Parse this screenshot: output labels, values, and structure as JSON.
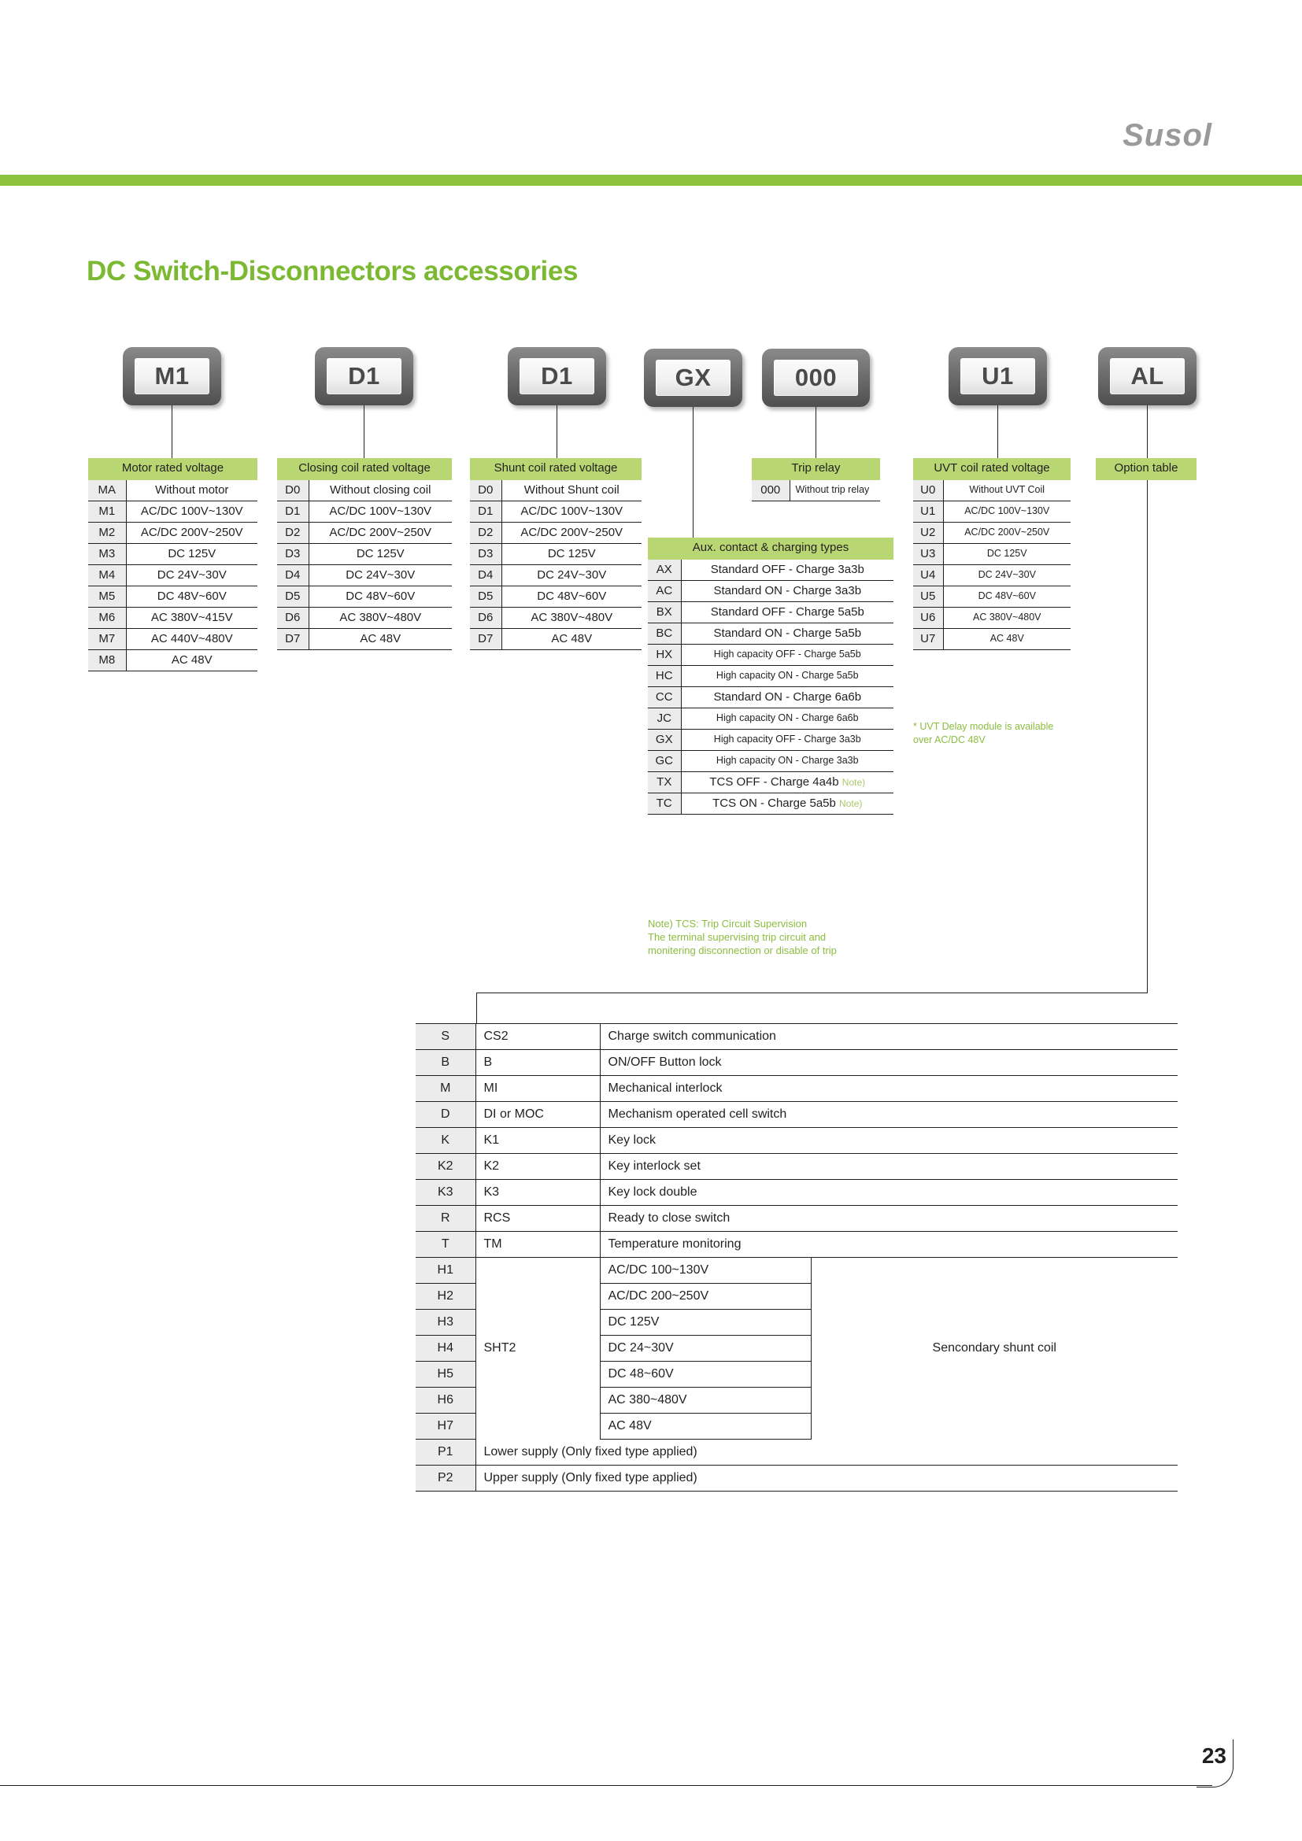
{
  "header": {
    "brand": "Susol",
    "page_title": "DC Switch-Disconnectors accessories"
  },
  "badges": [
    {
      "label": "M1"
    },
    {
      "label": "D1"
    },
    {
      "label": "D1"
    },
    {
      "label": "GX"
    },
    {
      "label": "000"
    },
    {
      "label": "U1"
    },
    {
      "label": "AL"
    }
  ],
  "sections": {
    "motor": {
      "title": "Motor rated voltage",
      "rows": [
        {
          "code": "MA",
          "value": "Without motor"
        },
        {
          "code": "M1",
          "value": "AC/DC 100V~130V"
        },
        {
          "code": "M2",
          "value": "AC/DC 200V~250V"
        },
        {
          "code": "M3",
          "value": "DC 125V"
        },
        {
          "code": "M4",
          "value": "DC 24V~30V"
        },
        {
          "code": "M5",
          "value": "DC 48V~60V"
        },
        {
          "code": "M6",
          "value": "AC 380V~415V"
        },
        {
          "code": "M7",
          "value": "AC 440V~480V"
        },
        {
          "code": "M8",
          "value": "AC 48V"
        }
      ]
    },
    "closing": {
      "title": "Closing coil rated voltage",
      "rows": [
        {
          "code": "D0",
          "value": "Without closing coil"
        },
        {
          "code": "D1",
          "value": "AC/DC 100V~130V"
        },
        {
          "code": "D2",
          "value": "AC/DC 200V~250V"
        },
        {
          "code": "D3",
          "value": "DC 125V"
        },
        {
          "code": "D4",
          "value": "DC 24V~30V"
        },
        {
          "code": "D5",
          "value": "DC 48V~60V"
        },
        {
          "code": "D6",
          "value": "AC 380V~480V"
        },
        {
          "code": "D7",
          "value": "AC 48V"
        }
      ]
    },
    "shunt": {
      "title": "Shunt coil rated voltage",
      "rows": [
        {
          "code": "D0",
          "value": "Without Shunt coil"
        },
        {
          "code": "D1",
          "value": "AC/DC 100V~130V"
        },
        {
          "code": "D2",
          "value": "AC/DC 200V~250V"
        },
        {
          "code": "D3",
          "value": "DC 125V"
        },
        {
          "code": "D4",
          "value": "DC 24V~30V"
        },
        {
          "code": "D5",
          "value": "DC 48V~60V"
        },
        {
          "code": "D6",
          "value": "AC 380V~480V"
        },
        {
          "code": "D7",
          "value": "AC 48V"
        }
      ]
    },
    "trip": {
      "title": "Trip relay",
      "rows": [
        {
          "code": "000",
          "value": "Without trip relay"
        }
      ]
    },
    "aux": {
      "title": "Aux. contact & charging types",
      "rows": [
        {
          "code": "AX",
          "value": "Standard OFF - Charge 3a3b",
          "note": ""
        },
        {
          "code": "AC",
          "value": "Standard ON - Charge 3a3b",
          "note": ""
        },
        {
          "code": "BX",
          "value": "Standard OFF - Charge 5a5b",
          "note": ""
        },
        {
          "code": "BC",
          "value": "Standard ON - Charge 5a5b",
          "note": ""
        },
        {
          "code": "HX",
          "value": "High capacity OFF - Charge 5a5b",
          "note": ""
        },
        {
          "code": "HC",
          "value": "High capacity ON - Charge 5a5b",
          "note": ""
        },
        {
          "code": "CC",
          "value": "Standard ON - Charge 6a6b",
          "note": ""
        },
        {
          "code": "JC",
          "value": "High capacity ON - Charge 6a6b",
          "note": ""
        },
        {
          "code": "GX",
          "value": "High capacity OFF - Charge 3a3b",
          "note": ""
        },
        {
          "code": "GC",
          "value": "High capacity ON - Charge 3a3b",
          "note": ""
        },
        {
          "code": "TX",
          "value": "TCS OFF - Charge 4a4b",
          "note": "Note)"
        },
        {
          "code": "TC",
          "value": "TCS ON - Charge 5a5b",
          "note": "Note)"
        }
      ],
      "footnote": "Note) TCS: Trip Circuit Supervision\nThe terminal supervising trip circuit and\nmonitering disconnection or disable of trip"
    },
    "uvt": {
      "title": "UVT coil rated voltage",
      "rows": [
        {
          "code": "U0",
          "value": "Without UVT Coil"
        },
        {
          "code": "U1",
          "value": "AC/DC 100V~130V"
        },
        {
          "code": "U2",
          "value": "AC/DC 200V~250V"
        },
        {
          "code": "U3",
          "value": "DC 125V"
        },
        {
          "code": "U4",
          "value": "DC 24V~30V"
        },
        {
          "code": "U5",
          "value": "DC 48V~60V"
        },
        {
          "code": "U6",
          "value": "AC 380V~480V"
        },
        {
          "code": "U7",
          "value": "AC 48V"
        }
      ],
      "footnote": "* UVT Delay module is available\n  over AC/DC 48V"
    },
    "option": {
      "title": "Option table"
    }
  },
  "option_table": {
    "simple_rows": [
      {
        "code": "S",
        "mid": "CS2",
        "desc": "Charge switch communication"
      },
      {
        "code": "B",
        "mid": "B",
        "desc": "ON/OFF Button lock"
      },
      {
        "code": "M",
        "mid": "MI",
        "desc": "Mechanical interlock"
      },
      {
        "code": "D",
        "mid": "DI or MOC",
        "desc": "Mechanism operated cell switch"
      },
      {
        "code": "K",
        "mid": "K1",
        "desc": "Key lock"
      },
      {
        "code": "K2",
        "mid": "K2",
        "desc": "Key interlock set"
      },
      {
        "code": "K3",
        "mid": "K3",
        "desc": "Key lock double"
      },
      {
        "code": "R",
        "mid": "RCS",
        "desc": "Ready to close switch"
      },
      {
        "code": "T",
        "mid": "TM",
        "desc": "Temperature monitoring"
      }
    ],
    "sht2_label": "SHT2",
    "sht2_desc": "Sencondary shunt coil",
    "sht2_rows": [
      {
        "code": "H1",
        "volt": "AC/DC 100~130V"
      },
      {
        "code": "H2",
        "volt": "AC/DC 200~250V"
      },
      {
        "code": "H3",
        "volt": "DC 125V"
      },
      {
        "code": "H4",
        "volt": "DC 24~30V"
      },
      {
        "code": "H5",
        "volt": "DC 48~60V"
      },
      {
        "code": "H6",
        "volt": "AC 380~480V"
      },
      {
        "code": "H7",
        "volt": "AC 48V"
      }
    ],
    "supply_rows": [
      {
        "code": "P1",
        "desc": "Lower supply (Only fixed type applied)"
      },
      {
        "code": "P2",
        "desc": "Upper supply (Only fixed type applied)"
      }
    ]
  },
  "footer": {
    "page_number": "23"
  }
}
